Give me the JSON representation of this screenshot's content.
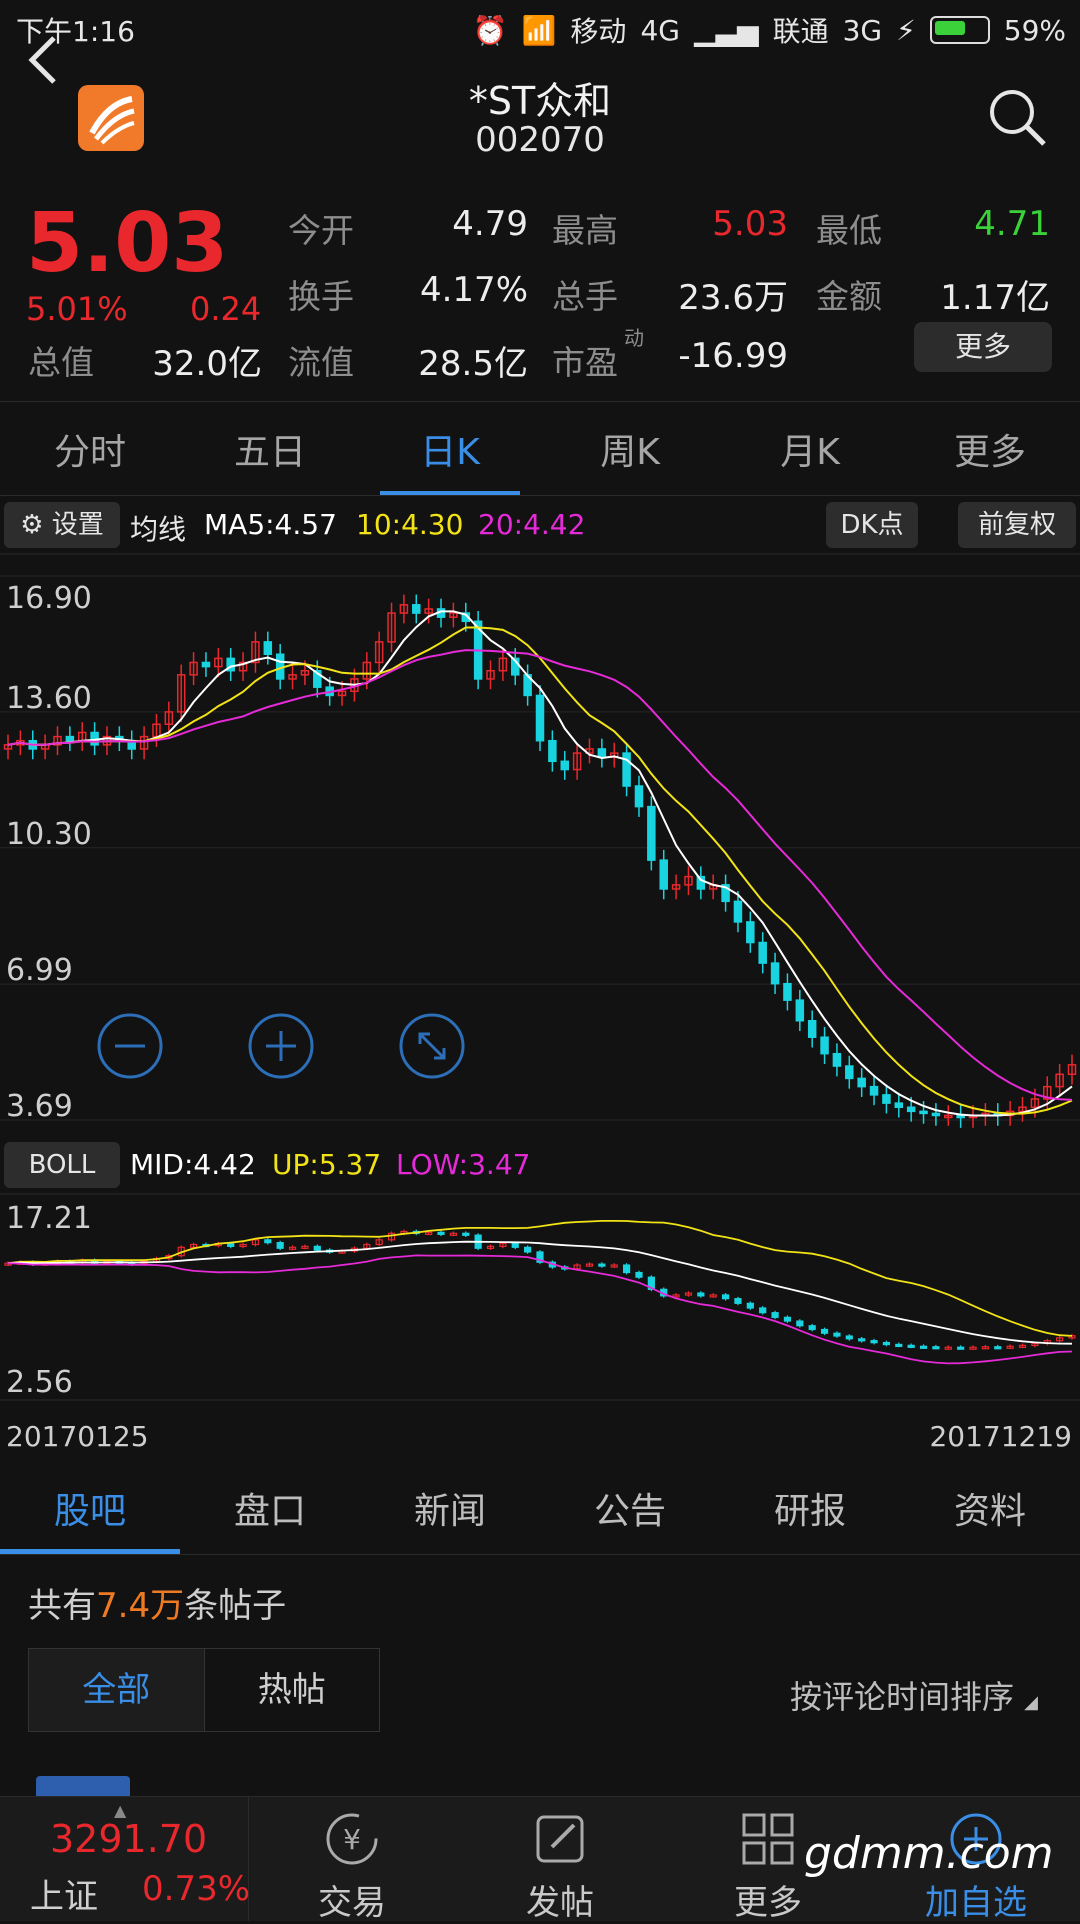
{
  "status": {
    "time": "下午1:16",
    "carrier1": "移动",
    "net1": "4G",
    "carrier2": "联通",
    "net2": "3G",
    "battery": "59%"
  },
  "header": {
    "title": "*ST众和",
    "code": "002070"
  },
  "quote": {
    "price": "5.03",
    "change_pct": "5.01%",
    "change": "0.24",
    "open_label": "今开",
    "open_value": "4.79",
    "high_label": "最高",
    "high_value": "5.03",
    "low_label": "最低",
    "low_value": "4.71",
    "turnover_label": "换手",
    "turnover_value": "4.17%",
    "volume_label": "总手",
    "volume_value": "23.6万",
    "amount_label": "金额",
    "amount_value": "1.17亿",
    "mktcap_label": "总值",
    "mktcap_value": "32.0亿",
    "float_label": "流值",
    "float_value": "28.5亿",
    "pe_label": "市盈",
    "pe_sup": "动",
    "pe_value": "-16.99",
    "more_label": "更多"
  },
  "tabs": [
    "分时",
    "五日",
    "日K",
    "周K",
    "月K",
    "更多"
  ],
  "active_tab": 2,
  "ma_bar": {
    "settings_label": "设置",
    "ma_label": "均线",
    "ma5": "MA5:4.57",
    "ma10": "10:4.30",
    "ma20": "20:4.42",
    "dk_label": "DK点",
    "adjust_label": "前复权"
  },
  "boll_bar": {
    "label": "BOLL",
    "mid": "MID:4.42",
    "up": "UP:5.37",
    "low": "LOW:3.47"
  },
  "colors": {
    "up": "#e8282d",
    "down": "#19d4e0",
    "ma5": "#ffffff",
    "ma10": "#f2e316",
    "ma20": "#e52ad8",
    "accent": "#3a8ee6"
  },
  "chart_data": [
    {
      "type": "candlestick",
      "title": "",
      "ytick_labels": [
        "16.90",
        "13.60",
        "10.30",
        "6.99",
        "3.69"
      ],
      "ylim": [
        3.69,
        16.9
      ],
      "ma5_last": 4.57,
      "ma10_last": 4.3,
      "ma20_last": 4.42,
      "trend_close": [
        12.8,
        12.9,
        12.7,
        12.8,
        13.0,
        12.9,
        13.1,
        12.8,
        13.0,
        12.9,
        12.7,
        13.0,
        13.3,
        13.6,
        14.5,
        14.8,
        14.7,
        14.9,
        14.6,
        14.8,
        15.3,
        15.0,
        14.4,
        14.5,
        14.6,
        14.2,
        14.0,
        14.1,
        14.4,
        14.8,
        15.3,
        16.0,
        16.2,
        16.0,
        16.1,
        15.9,
        16.0,
        15.8,
        14.4,
        14.6,
        14.9,
        14.5,
        14.0,
        12.9,
        12.4,
        12.2,
        12.6,
        12.7,
        12.5,
        12.6,
        11.8,
        11.3,
        10.0,
        9.3,
        9.4,
        9.6,
        9.3,
        9.4,
        9.0,
        8.5,
        8.0,
        7.5,
        7.0,
        6.6,
        6.1,
        5.7,
        5.3,
        5.0,
        4.7,
        4.5,
        4.3,
        4.1,
        4.0,
        3.9,
        3.85,
        3.8,
        3.8,
        3.75,
        3.8,
        3.85,
        3.8,
        3.9,
        4.0,
        4.2,
        4.5,
        4.8,
        5.03
      ]
    },
    {
      "type": "line",
      "title": "",
      "ytick_labels": [
        "17.21",
        "2.56"
      ],
      "ylim": [
        2.56,
        17.21
      ],
      "mid_last": 4.42,
      "up_last": 5.37,
      "low_last": 3.47
    }
  ],
  "date_start": "20170125",
  "date_end": "20171219",
  "sub_tabs": [
    "股吧",
    "盘口",
    "新闻",
    "公告",
    "研报",
    "资料"
  ],
  "posts": {
    "prefix": "共有",
    "count": "7.4万",
    "suffix": "条帖子",
    "filter_all": "全部",
    "filter_hot": "热帖",
    "sort_label": "按评论时间排序"
  },
  "bottom": {
    "index_value": "3291.70",
    "index_name": "上证",
    "index_pct": "0.73%",
    "trade": "交易",
    "post": "发帖",
    "more": "更多",
    "add": "加自选"
  },
  "watermark": "gdmm.com"
}
